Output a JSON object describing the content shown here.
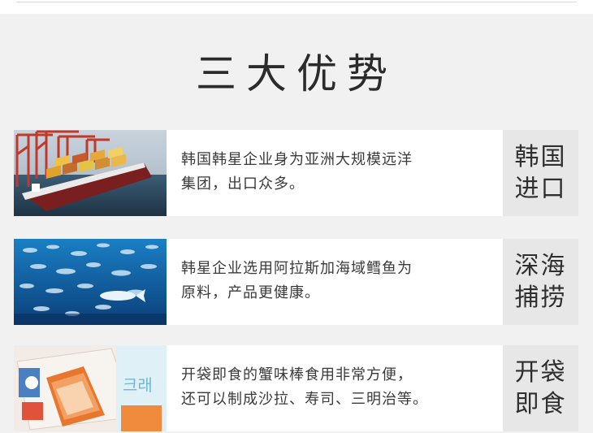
{
  "title": "三大优势",
  "items": [
    {
      "image_icon": "container-ship-image",
      "desc_line1": "韩国韩星企业身为亚洲大规模远洋",
      "desc_line2": "集团，出口众多。",
      "tag_line1": "韩国",
      "tag_line2": "进口"
    },
    {
      "image_icon": "fish-school-image",
      "desc_line1": "韩星企业选用阿拉斯加海域鳕鱼为",
      "desc_line2": "原料，产品更健康。",
      "tag_line1": "深海",
      "tag_line2": "捕捞"
    },
    {
      "image_icon": "crab-stick-package-image",
      "desc_line1": "开袋即食的蟹味棒食用非常方便，",
      "desc_line2": "还可以制成沙拉、寿司、三明治等。",
      "tag_line1": "开袋",
      "tag_line2": "即食"
    }
  ],
  "package_text": "크래",
  "colors": {
    "panel_bg": "#f1f1f1",
    "tag_bg": "#e7e7e7",
    "text": "#3a3a3a"
  }
}
